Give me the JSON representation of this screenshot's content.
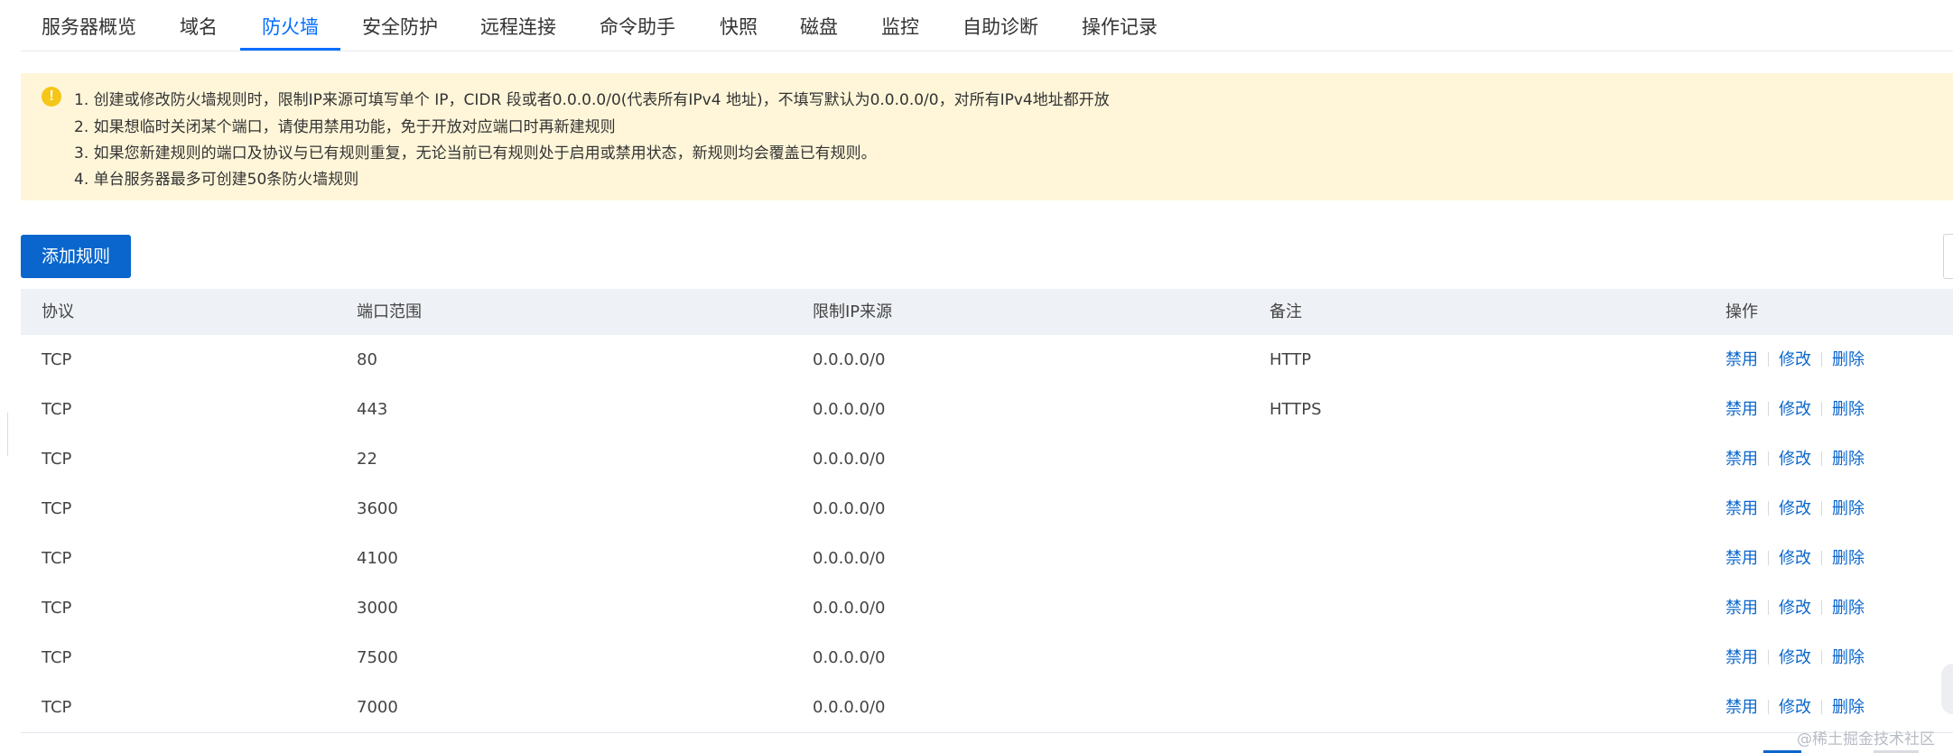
{
  "tabs": [
    {
      "label": "服务器概览",
      "active": false
    },
    {
      "label": "域名",
      "active": false
    },
    {
      "label": "防火墙",
      "active": true
    },
    {
      "label": "安全防护",
      "active": false
    },
    {
      "label": "远程连接",
      "active": false
    },
    {
      "label": "命令助手",
      "active": false
    },
    {
      "label": "快照",
      "active": false
    },
    {
      "label": "磁盘",
      "active": false
    },
    {
      "label": "监控",
      "active": false
    },
    {
      "label": "自助诊断",
      "active": false
    },
    {
      "label": "操作记录",
      "active": false
    }
  ],
  "notice": {
    "icon": "warning-icon",
    "icon_glyph": "!",
    "lines": [
      "1. 创建或修改防火墙规则时，限制IP来源可填写单个 IP，CIDR 段或者0.0.0.0/0(代表所有IPv4 地址)，不填写默认为0.0.0.0/0，对所有IPv4地址都开放",
      "2. 如果想临时关闭某个端口，请使用禁用功能，免于开放对应端口时再新建规则",
      "3. 如果您新建规则的端口及协议与已有规则重复，无论当前已有规则处于启用或禁用状态，新规则均会覆盖已有规则。",
      "4. 单台服务器最多可创建50条防火墙规则"
    ]
  },
  "toolbar": {
    "add_rule_label": "添加规则"
  },
  "table": {
    "headers": {
      "protocol": "协议",
      "port": "端口范围",
      "source": "限制IP来源",
      "remark": "备注",
      "actions": "操作"
    },
    "action_labels": {
      "disable": "禁用",
      "edit": "修改",
      "delete": "删除"
    },
    "rows": [
      {
        "protocol": "TCP",
        "port": "80",
        "source": "0.0.0.0/0",
        "remark": "HTTP"
      },
      {
        "protocol": "TCP",
        "port": "443",
        "source": "0.0.0.0/0",
        "remark": "HTTPS"
      },
      {
        "protocol": "TCP",
        "port": "22",
        "source": "0.0.0.0/0",
        "remark": ""
      },
      {
        "protocol": "TCP",
        "port": "3600",
        "source": "0.0.0.0/0",
        "remark": ""
      },
      {
        "protocol": "TCP",
        "port": "4100",
        "source": "0.0.0.0/0",
        "remark": ""
      },
      {
        "protocol": "TCP",
        "port": "3000",
        "source": "0.0.0.0/0",
        "remark": ""
      },
      {
        "protocol": "TCP",
        "port": "7500",
        "source": "0.0.0.0/0",
        "remark": ""
      },
      {
        "protocol": "TCP",
        "port": "7000",
        "source": "0.0.0.0/0",
        "remark": ""
      }
    ]
  },
  "watermark": "@稀土掘金技术社区",
  "colors": {
    "accent": "#006eff",
    "link": "#0a66cc",
    "notice_bg": "#fff6d9",
    "warning": "#f5c518",
    "header_bg": "#eef1f5"
  }
}
